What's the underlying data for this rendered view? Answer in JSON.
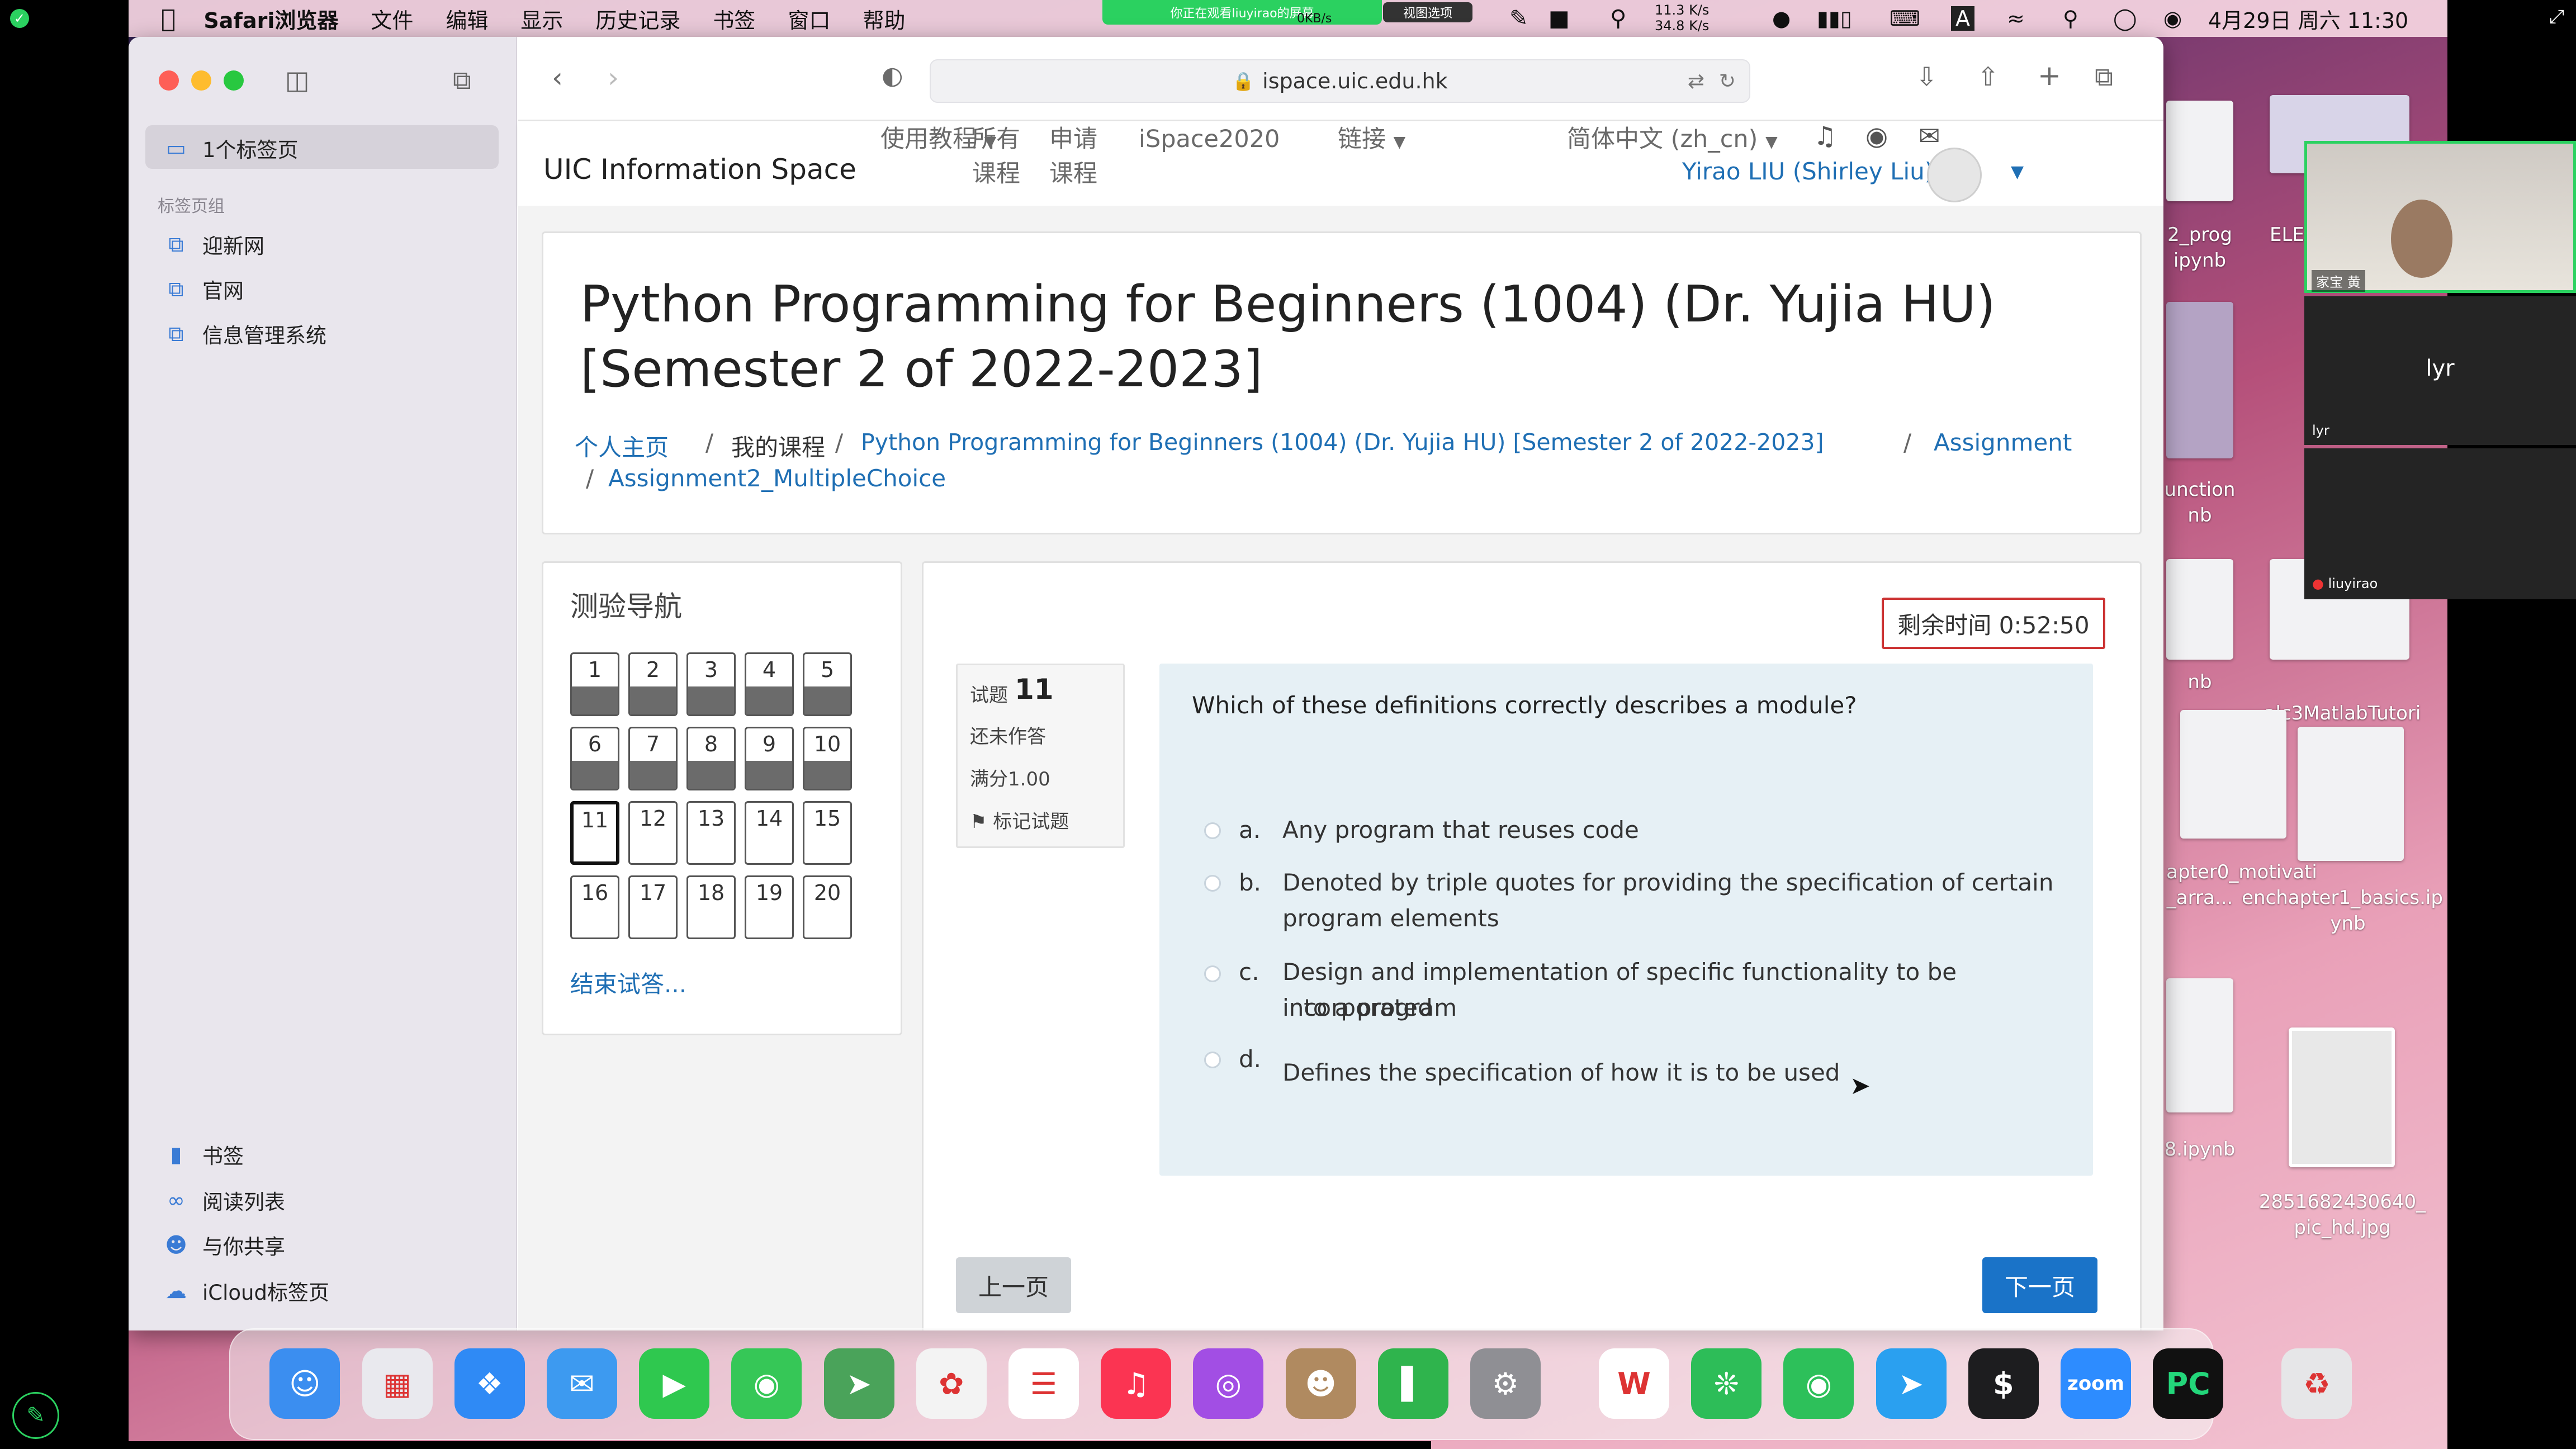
{
  "menubar": {
    "app_name": "Safari浏览器",
    "items": [
      "文件",
      "编辑",
      "显示",
      "历史记录",
      "书签",
      "窗口",
      "帮助"
    ],
    "share_banner": "你正在观看liuyirao的屏幕",
    "view_options": "视图选项",
    "net_speed_up": "11.3 K/s",
    "net_speed_down": "34.8 K/s",
    "net_small": "0KB/s",
    "datetime": "4月29日 周六  11:30"
  },
  "sidebar": {
    "tab_count": "1个标签页",
    "section_title": "标签页组",
    "groups": [
      "迎新网",
      "官网",
      "信息管理系统"
    ],
    "bottom": [
      "书签",
      "阅读列表",
      "与你共享",
      "iCloud标签页"
    ]
  },
  "toolbar": {
    "url": "ispace.uic.edu.hk"
  },
  "navbar": {
    "site_name": "UIC Information Space",
    "menu1": "使用教程",
    "menu2_line1": "所有",
    "menu2_line2": "课程",
    "menu3_line1": "申请",
    "menu3_line2": "课程",
    "menu4": "iSpace2020",
    "menu5": "链接",
    "menu6": "简体中文 (zh_cn)",
    "user": "Yirao LIU (Shirley Liu)"
  },
  "header": {
    "title_line1": "Python Programming for Beginners (1004) (Dr. Yujia HU)",
    "title_line2": "[Semester 2 of 2022-2023]",
    "breadcrumb": [
      "个人主页",
      "我的课程",
      "Python Programming for Beginners (1004) (Dr. Yujia HU) [Semester 2 of 2022-2023]",
      "Assignment",
      "Assignment2_MultipleChoice"
    ]
  },
  "quiz_nav": {
    "title": "测验导航",
    "numbers": [
      "1",
      "2",
      "3",
      "4",
      "5",
      "6",
      "7",
      "8",
      "9",
      "10",
      "11",
      "12",
      "13",
      "14",
      "15",
      "16",
      "17",
      "18",
      "19",
      "20"
    ],
    "answered_count": 10,
    "current": 11,
    "finish": "结束试答..."
  },
  "question": {
    "timer": "剩余时间 0:52:50",
    "label": "试题",
    "number": "11",
    "status": "还未作答",
    "marks": "满分1.00",
    "flag": "标记试题",
    "text": "Which of these definitions correctly describes a module?",
    "options": [
      {
        "letter": "a.",
        "line1": "Any program that reuses code",
        "line2": ""
      },
      {
        "letter": "b.",
        "line1": "Denoted by triple quotes for providing the specification of certain",
        "line2": "program elements"
      },
      {
        "letter": "c.",
        "line1": "Design and implementation of specific functionality to be incorporated",
        "line2": "into a program"
      },
      {
        "letter": "d.",
        "line1": "Defines the specification of how it is to be used",
        "line2": ""
      }
    ],
    "prev": "上一页",
    "next": "下一页"
  },
  "zoom": {
    "participant1": "家宝 黄",
    "participant2_big": "lyr",
    "participant2_small": "lyr",
    "participant3": "liuyirao"
  },
  "desktop": {
    "labels": [
      "2_prog",
      "ipynb",
      "ELE",
      "unction",
      "nb",
      "nb",
      "alc3MatlabTutori",
      "apter0_motivati",
      "_arra...",
      "enchapter1_basics.ip",
      "ynb",
      "8.ipynb",
      "2851682430640_",
      "pic_hd.jpg"
    ]
  },
  "dock": {
    "apps": [
      "Finder",
      "Launchpad",
      "Safari",
      "Mail",
      "FaceTime",
      "Messages",
      "Maps",
      "Photos",
      "Reminders",
      "Music",
      "Podcasts",
      "Contacts",
      "Numbers",
      "System Settings",
      "WPS",
      "Evernote",
      "WeChat",
      "Feishu",
      "Terminal",
      "Zoom",
      "PyCharm",
      "Trash"
    ]
  },
  "colors": {
    "accent": "#1f6fb4",
    "next_button": "#1a73c8",
    "question_bg": "#e6f0f5",
    "timer_border": "#c33"
  }
}
